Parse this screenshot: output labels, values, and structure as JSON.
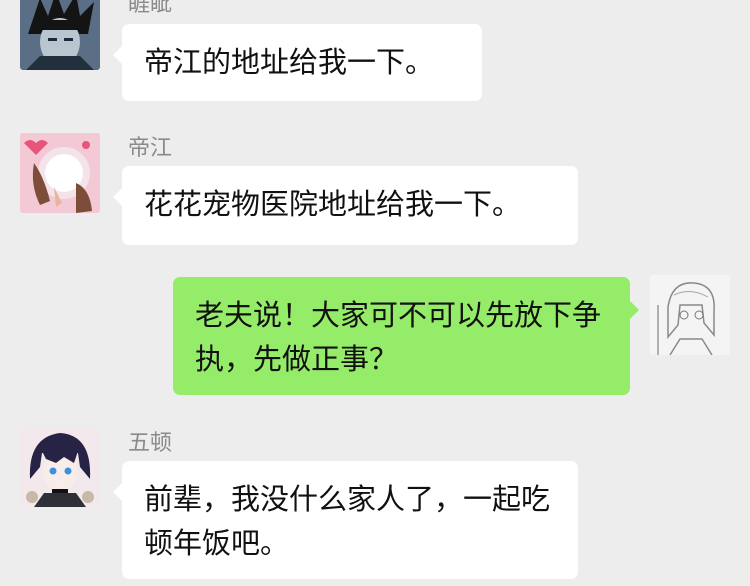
{
  "messages": [
    {
      "sender": "睚眦",
      "text": "帝江的地址给我一下。",
      "direction": "in",
      "avatar_icon": "dark-haired-boy-avatar-icon"
    },
    {
      "sender": "帝江",
      "text": "花花宠物医院地址给我一下。",
      "direction": "in",
      "avatar_icon": "pink-anime-avatar-icon"
    },
    {
      "sender": "",
      "text": "老夫说！大家可不可以先放下争执，先做正事？",
      "direction": "out",
      "avatar_icon": "sketch-anime-avatar-icon"
    },
    {
      "sender": "五顿",
      "text": "前辈，我没什么家人了，一起吃顿年饭吧。",
      "direction": "in",
      "avatar_icon": "blue-eyed-anime-avatar-icon"
    }
  ],
  "colors": {
    "background": "#ededed",
    "incoming_bubble": "#ffffff",
    "outgoing_bubble": "#95ec69",
    "sender_name": "#8a8a8a"
  }
}
